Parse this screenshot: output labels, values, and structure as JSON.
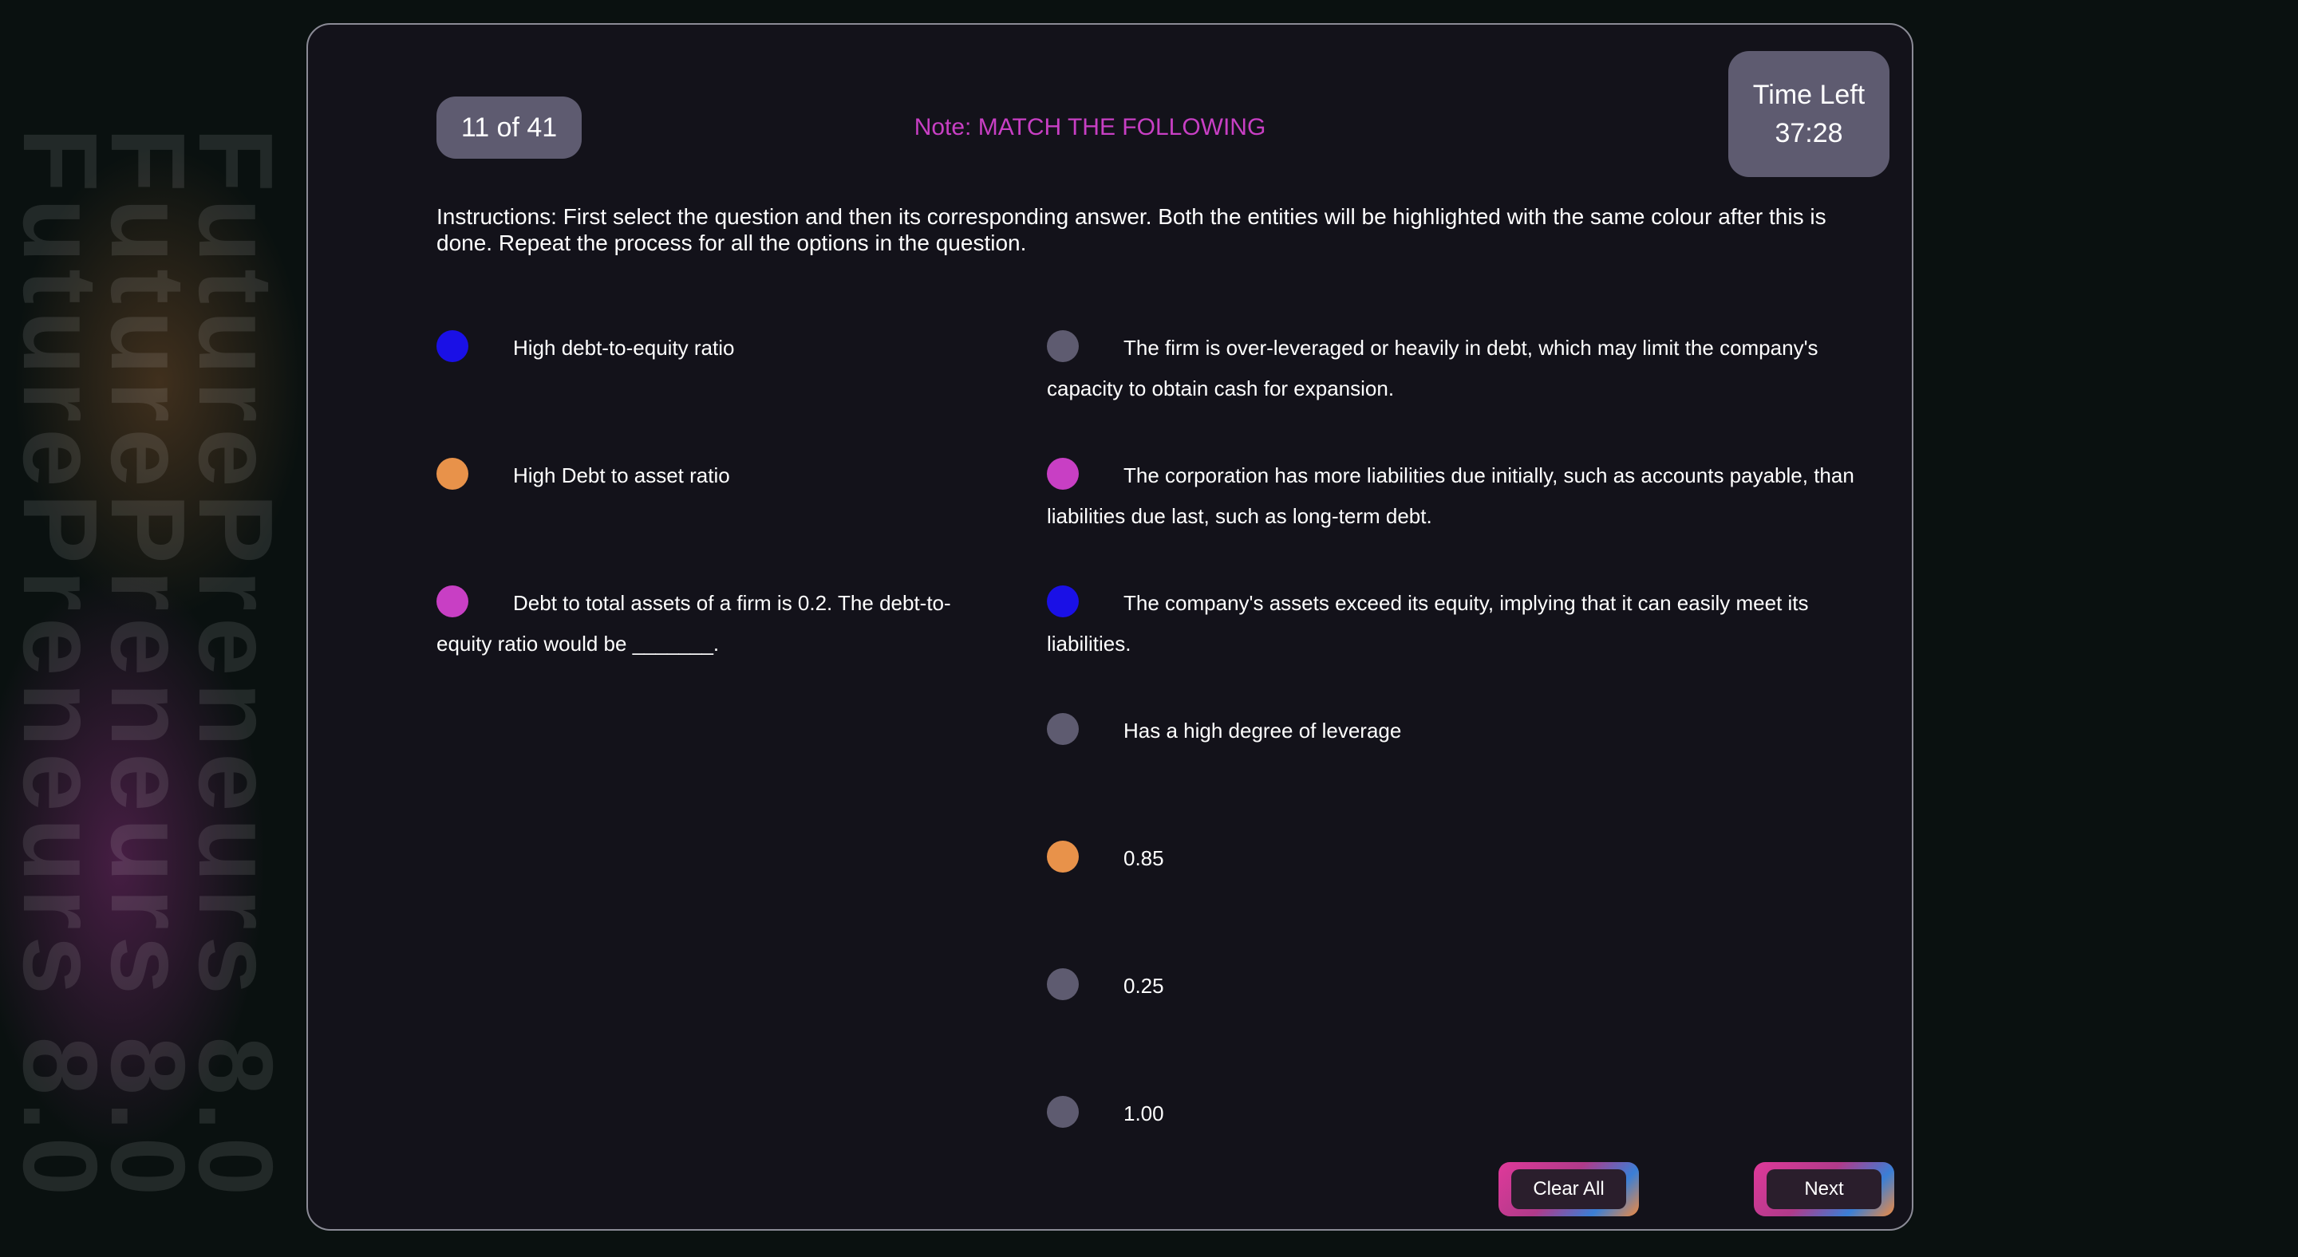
{
  "watermark": {
    "text": "FuturePreneurs 8.0"
  },
  "header": {
    "counter": "11 of 41",
    "note": "Note: MATCH THE FOLLOWING",
    "timer_label": "Time Left",
    "timer_value": "37:28"
  },
  "instructions": "Instructions: First select the question and then its corresponding answer. Both the entities will be highlighted with the same colour after this is done. Repeat the process for all the options in the question.",
  "questions": [
    {
      "text": "High debt-to-equity ratio",
      "color": "#1a10e6"
    },
    {
      "text": "High Debt to asset ratio",
      "color": "#e8924a"
    },
    {
      "text": "Debt to total assets of a firm is 0.2. The debt-to-equity ratio would be _______.",
      "color": "#c83fc4"
    }
  ],
  "answers": [
    {
      "text": "The firm is over-leveraged or heavily in debt, which may limit the company's capacity to obtain cash for expansion.",
      "color": "#5e5b70"
    },
    {
      "text": "The corporation has more liabilities due initially, such as accounts payable, than liabilities due last, such as long-term debt.",
      "color": "#c83fc4"
    },
    {
      "text": "The company's assets exceed its equity, implying that it can easily meet its liabilities.",
      "color": "#1a10e6"
    },
    {
      "text": "Has a high degree of leverage",
      "color": "#5e5b70"
    },
    {
      "text": "0.85",
      "color": "#e8924a"
    },
    {
      "text": "0.25",
      "color": "#5e5b70"
    },
    {
      "text": "1.00",
      "color": "#5e5b70"
    }
  ],
  "buttons": {
    "clear_all": "Clear All",
    "next": "Next"
  },
  "colors": {
    "accent": "#c83fc4",
    "panel": "#13121a",
    "chip": "#5e5b70"
  }
}
